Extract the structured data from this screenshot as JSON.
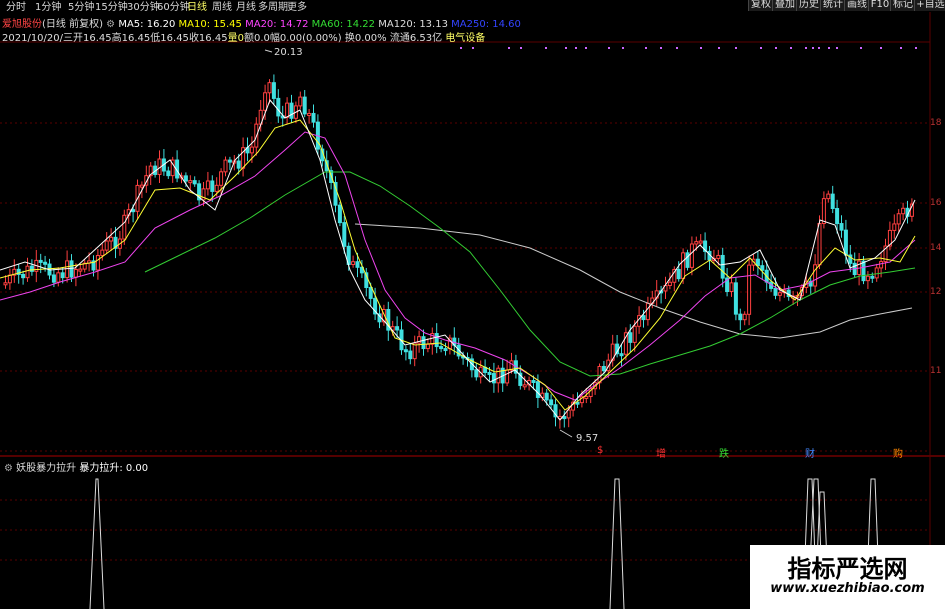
{
  "periods": [
    "分时",
    "1分钟",
    "5分钟",
    "15分钟",
    "30分钟",
    "60分钟",
    "日线",
    "周线",
    "月线",
    "多周期",
    "更多"
  ],
  "active_period": "日线",
  "right_buttons": [
    "复权",
    "叠加",
    "历史",
    "统计",
    "画线",
    "F10",
    "标记",
    "+自选"
  ],
  "stock": {
    "name": "爱旭股份",
    "mode": "(日线 前复权)"
  },
  "ma": [
    {
      "label": "MA5: 16.20",
      "color": "#ffffff"
    },
    {
      "label": "MA10: 15.45",
      "color": "#ffff00"
    },
    {
      "label": "MA20: 14.72",
      "color": "#ff44ff"
    },
    {
      "label": "MA60: 14.22",
      "color": "#33dd33"
    },
    {
      "label": "MA120: 13.13",
      "color": "#dddddd"
    },
    {
      "label": "MA250: 14.60",
      "color": "#3344ff"
    }
  ],
  "quote": {
    "date": "2021/10/20/三",
    "open": "开16.45",
    "high": "高16.45",
    "low": "低16.45",
    "close": "收16.45",
    "vol": "量0",
    "amount": "额0.0",
    "change": "幅0.00(0.00%)",
    "turnover": "换0.00%",
    "float": "流通6.53亿",
    "sector": "电气设备"
  },
  "price_marks": {
    "high": "20.13",
    "low": "9.57"
  },
  "signals": [
    {
      "text": "$",
      "color": "#ff3333"
    },
    {
      "text": "增",
      "color": "#ff3333"
    },
    {
      "text": "跌",
      "color": "#33dd33"
    },
    {
      "text": "财",
      "color": "#4488ff"
    },
    {
      "text": "购",
      "color": "#ff8800"
    }
  ],
  "y_labels": [
    "18",
    "16",
    "14",
    "12",
    "11"
  ],
  "indicator": {
    "name": "妖股暴力拉升",
    "value": "暴力拉升: 0.00"
  },
  "watermark": {
    "title": "指标严选网",
    "url": "www.xuezhibiao.com"
  }
}
